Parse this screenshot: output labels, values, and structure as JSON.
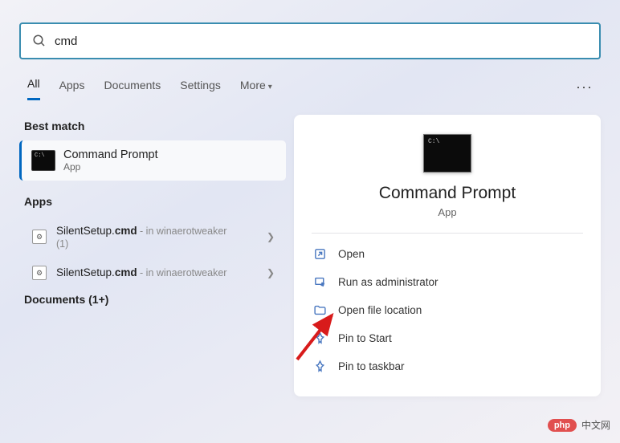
{
  "search": {
    "value": "cmd"
  },
  "tabs": {
    "items": [
      "All",
      "Apps",
      "Documents",
      "Settings",
      "More"
    ],
    "active": "All"
  },
  "sections": {
    "best_match": "Best match",
    "apps": "Apps",
    "documents": "Documents (1+)"
  },
  "best_match": {
    "title": "Command Prompt",
    "subtitle": "App"
  },
  "apps_list": [
    {
      "name": "SilentSetup.",
      "ext": "cmd",
      "meta": " - in winaerotweaker",
      "count": "(1)"
    },
    {
      "name": "SilentSetup.",
      "ext": "cmd",
      "meta": " - in winaerotweaker",
      "count": ""
    }
  ],
  "preview": {
    "title": "Command Prompt",
    "subtitle": "App",
    "actions": [
      {
        "icon": "open-icon",
        "label": "Open"
      },
      {
        "icon": "admin-icon",
        "label": "Run as administrator"
      },
      {
        "icon": "folder-icon",
        "label": "Open file location"
      },
      {
        "icon": "pin-icon",
        "label": "Pin to Start"
      },
      {
        "icon": "pin-icon",
        "label": "Pin to taskbar"
      }
    ]
  },
  "watermark": {
    "badge": "php",
    "text": "中文网"
  }
}
